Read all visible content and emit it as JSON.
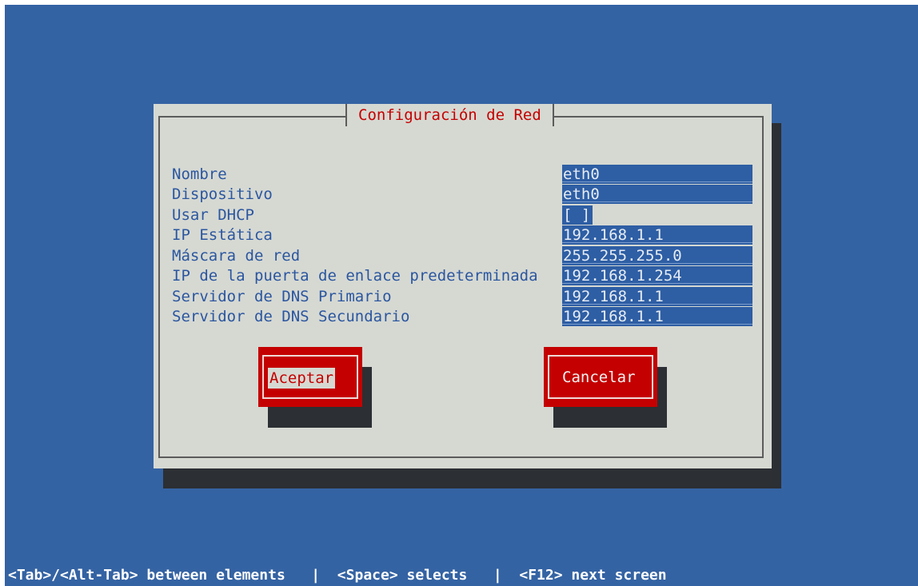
{
  "dialog": {
    "title": "Configuración de Red",
    "fields": [
      {
        "label": "Nombre",
        "value": "eth0"
      },
      {
        "label": "Dispositivo",
        "value": "eth0"
      },
      {
        "label": "Usar DHCP",
        "value": "[ ]"
      },
      {
        "label": "IP Estática",
        "value": "192.168.1.1"
      },
      {
        "label": "Máscara de red",
        "value": "255.255.255.0"
      },
      {
        "label": "IP de la puerta de enlace predeterminada",
        "value": "192.168.1.254"
      },
      {
        "label": "Servidor de DNS Primario",
        "value": "192.168.1.1"
      },
      {
        "label": "Servidor de DNS Secundario",
        "value": "192.168.1.1"
      }
    ],
    "buttons": {
      "accept": "Aceptar",
      "cancel": "Cancelar"
    }
  },
  "statusbar": {
    "text": "<Tab>/<Alt-Tab> between elements   |  <Space> selects   |  <F12> next screen"
  },
  "colors": {
    "background": "#3463a3",
    "dialog": "#d6d9d2",
    "accent_red": "#c40000",
    "field_blue": "#2e5ea4",
    "label_blue": "#2b56a0"
  }
}
